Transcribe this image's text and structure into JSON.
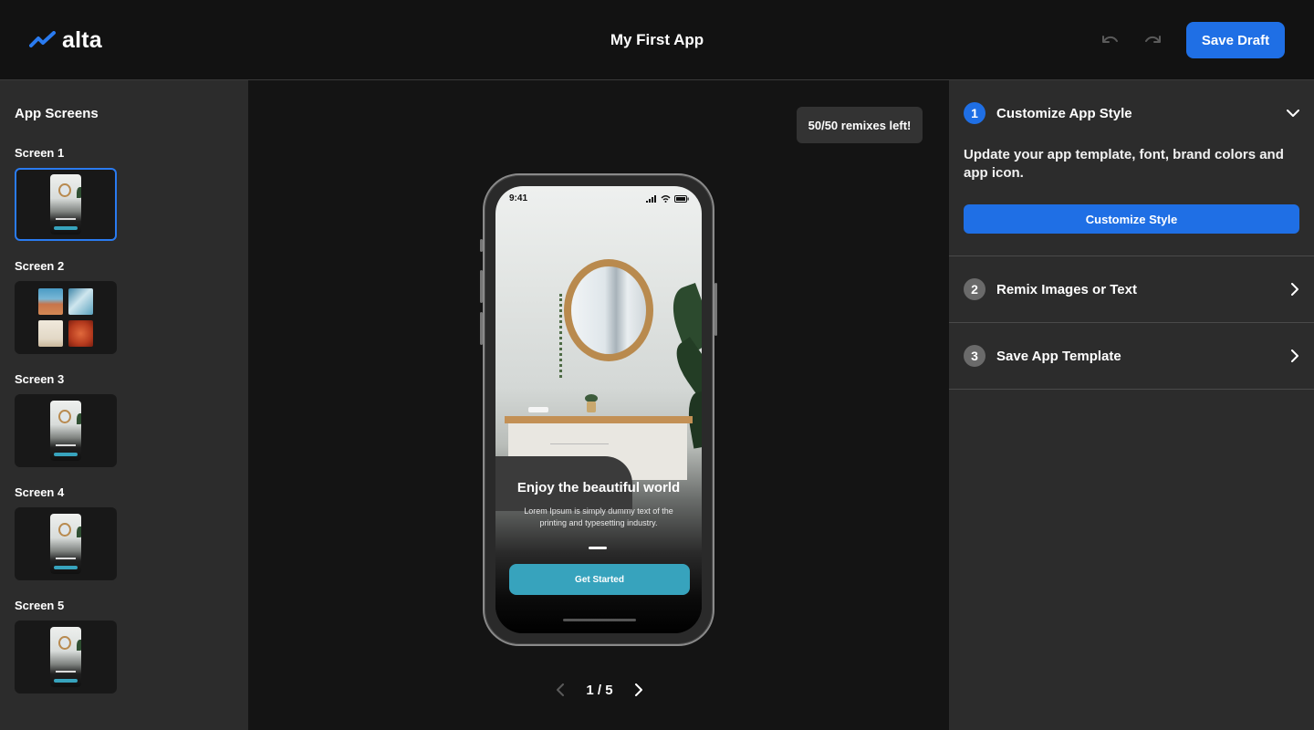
{
  "header": {
    "logo_text": "alta",
    "app_title": "My First App",
    "undo_icon": "undo-icon",
    "redo_icon": "redo-icon",
    "save_draft_label": "Save Draft"
  },
  "sidebar": {
    "title": "App Screens",
    "screens": [
      {
        "label": "Screen 1",
        "active": true
      },
      {
        "label": "Screen 2",
        "active": false
      },
      {
        "label": "Screen 3",
        "active": false
      },
      {
        "label": "Screen 4",
        "active": false
      },
      {
        "label": "Screen 5",
        "active": false
      }
    ]
  },
  "canvas": {
    "remix_badge": "50/50 remixes left!",
    "phone": {
      "status_time": "9:41",
      "heading": "Enjoy the beautiful world",
      "body": "Lorem Ipsum is simply dummy text of the printing and typesetting industry.",
      "cta_label": "Get Started"
    },
    "pager": {
      "text": "1 / 5",
      "prev_icon": "chevron-left-icon",
      "next_icon": "chevron-right-icon"
    }
  },
  "steps": [
    {
      "number": "1",
      "title": "Customize App Style",
      "expanded": true,
      "description": "Update your app template, font, brand colors and app icon.",
      "button_label": "Customize Style"
    },
    {
      "number": "2",
      "title": "Remix Images or Text",
      "expanded": false
    },
    {
      "number": "3",
      "title": "Save App Template",
      "expanded": false
    }
  ],
  "colors": {
    "accent": "#1f6fe5",
    "cta_teal": "#37a3bd",
    "panel_bg": "#2c2c2c",
    "canvas_bg": "#141414"
  }
}
